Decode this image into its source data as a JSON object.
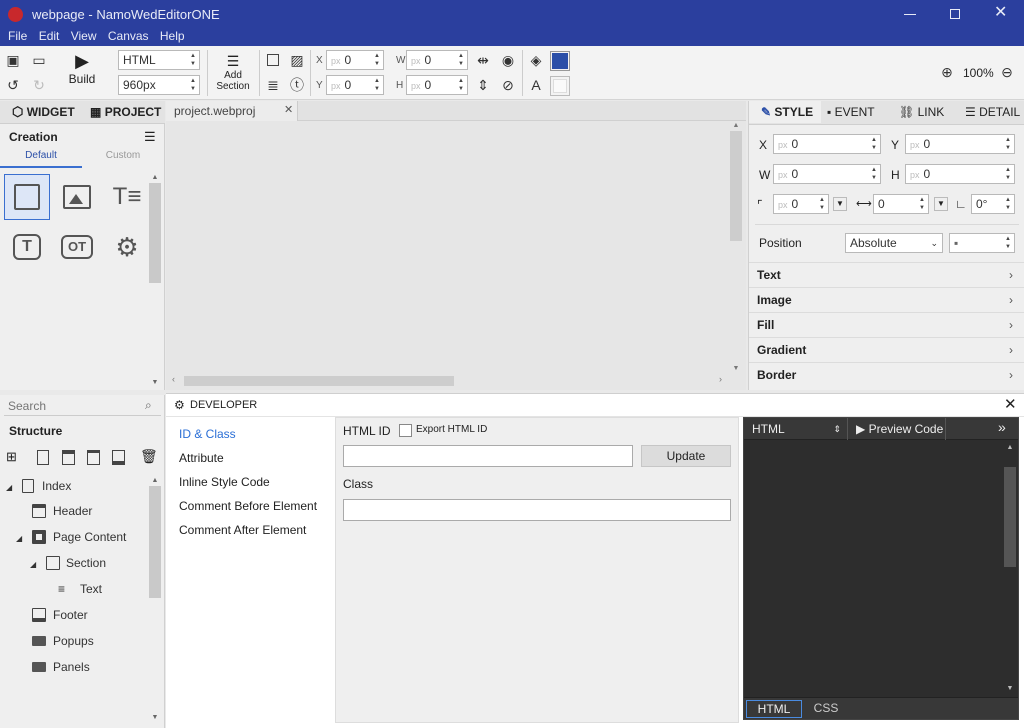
{
  "window": {
    "title": "webpage - NamoWedEditorONE"
  },
  "menu": [
    "File",
    "Edit",
    "View",
    "Canvas",
    "Help"
  ],
  "toolbar": {
    "build_label": "Build",
    "doc_type": "HTML",
    "width_value": "960px",
    "add_section_line1": "Add",
    "add_section_line2": "Section",
    "x_label": "X",
    "y_label": "Y",
    "w_label": "W",
    "h_label": "H",
    "px_hint": "px",
    "x_value": "0",
    "y_value": "0",
    "w_value": "0",
    "h_value": "0",
    "zoom": "100%",
    "accent_color": "#2b4fa8"
  },
  "left_panel": {
    "tab_widget": "WIDGET",
    "tab_project": "PROJECT",
    "section_title": "Creation",
    "subtab_default": "Default",
    "subtab_custom": "Custom",
    "widget_icons": [
      "box-icon",
      "image-icon",
      "text-lines-icon",
      "text-icon",
      "text-field-icon",
      "gear-icon"
    ]
  },
  "document_tab": {
    "label": "project.webproj"
  },
  "right_panel": {
    "tab_style": "STYLE",
    "tab_event": "EVENT",
    "tab_link": "LINK",
    "tab_detail": "DETAIL",
    "x_label": "X",
    "y_label": "Y",
    "w_label": "W",
    "h_label": "H",
    "px_hint": "px",
    "x_value": "0",
    "y_value": "0",
    "w_value": "0",
    "h_value": "0",
    "radius_value": "0",
    "spacing_value": "0",
    "angle_value": "0°",
    "position_label": "Position",
    "position_value": "Absolute",
    "sections": [
      "Text",
      "Image",
      "Fill",
      "Gradient",
      "Border"
    ]
  },
  "structure_panel": {
    "search_placeholder": "Search",
    "title": "Structure",
    "tree": [
      {
        "label": "Index",
        "icon": "page-icon"
      },
      {
        "label": "Header",
        "icon": "header-icon"
      },
      {
        "label": "Page Content",
        "icon": "content-icon"
      },
      {
        "label": "Section",
        "icon": "section-icon"
      },
      {
        "label": "Text",
        "icon": "text-icon"
      },
      {
        "label": "Footer",
        "icon": "footer-icon"
      },
      {
        "label": "Popups",
        "icon": "folder-icon"
      },
      {
        "label": "Panels",
        "icon": "folder-icon"
      }
    ]
  },
  "developer": {
    "title": "DEVELOPER",
    "nav": [
      "ID & Class",
      "Attribute",
      "Inline Style Code",
      "Comment Before Element",
      "Comment After Element"
    ],
    "html_id_label": "HTML ID",
    "export_label": "Export HTML ID",
    "update_label": "Update",
    "class_label": "Class",
    "code_mode": "HTML",
    "preview_label": "Preview Code",
    "bottom_tabs": [
      "HTML",
      "CSS"
    ]
  }
}
